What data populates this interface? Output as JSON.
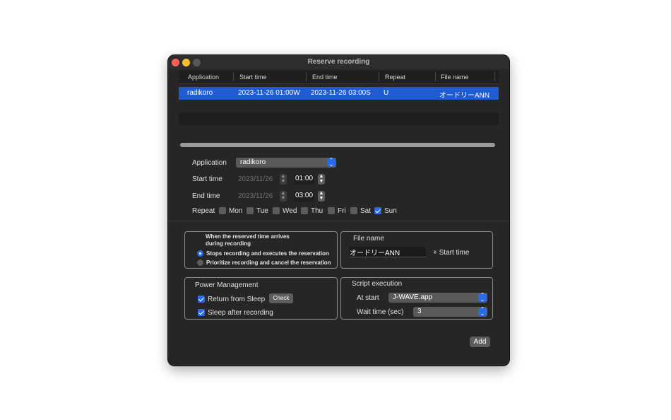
{
  "window": {
    "title": "Reserve recording"
  },
  "table": {
    "columns": [
      "Application",
      "Start time",
      "End time",
      "Repeat",
      "File name"
    ],
    "rows": [
      [
        "radikoro",
        "2023-11-26 01:00W",
        "2023-11-26 03:00S",
        "U",
        "オードリーANN"
      ]
    ]
  },
  "form": {
    "application_label": "Application",
    "application_value": "radikoro",
    "start_label": "Start time",
    "start_date": "2023/11/26",
    "start_time": "01:00",
    "end_label": "End time",
    "end_date": "2023/11/26",
    "end_time": "03:00",
    "repeat_label": "Repeat",
    "days": [
      {
        "label": "Mon",
        "checked": false
      },
      {
        "label": "Tue",
        "checked": false
      },
      {
        "label": "Wed",
        "checked": false
      },
      {
        "label": "Thu",
        "checked": false
      },
      {
        "label": "Fri",
        "checked": false
      },
      {
        "label": "Sat",
        "checked": false
      },
      {
        "label": "Sun",
        "checked": true
      }
    ]
  },
  "conflict": {
    "title_line1": "When the reserved time arrives",
    "title_line2": "during recording",
    "option1": "Stops recording and executes the reservation",
    "option2": "Prioritize recording and cancel the reservation"
  },
  "filename": {
    "label": "File name",
    "value": "オードリーANN",
    "suffix": "+ Start time"
  },
  "power": {
    "label": "Power Management",
    "return_label": "Return from Sleep",
    "check_button": "Check",
    "sleep_label": "Sleep after recording"
  },
  "script": {
    "label": "Script execution",
    "at_start_label": "At start",
    "at_start_value": "J-WAVE.app",
    "wait_label": "Wait time (sec)",
    "wait_value": "3"
  },
  "actions": {
    "add": "Add"
  },
  "colors": {
    "accent": "#2b6ae8",
    "selection": "#1f5bd1",
    "window_bg": "#262626"
  }
}
